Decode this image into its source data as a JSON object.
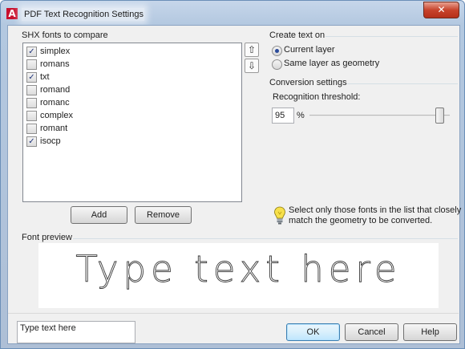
{
  "window": {
    "title": "PDF Text Recognition Settings",
    "close_glyph": "✕"
  },
  "fonts_group": {
    "label": "SHX fonts to compare",
    "items": [
      {
        "label": "simplex",
        "checked": true
      },
      {
        "label": "romans",
        "checked": false
      },
      {
        "label": "txt",
        "checked": true
      },
      {
        "label": "romand",
        "checked": false
      },
      {
        "label": "romanc",
        "checked": false
      },
      {
        "label": "complex",
        "checked": false
      },
      {
        "label": "romant",
        "checked": false
      },
      {
        "label": "isocp",
        "checked": true
      }
    ],
    "move_up_icon": "move-up-icon",
    "move_down_icon": "move-down-icon",
    "add_label": "Add",
    "remove_label": "Remove"
  },
  "create_text_on": {
    "label": "Create text on",
    "options": [
      {
        "label": "Current layer",
        "selected": true
      },
      {
        "label": "Same layer as geometry",
        "selected": false
      }
    ]
  },
  "conversion": {
    "label": "Conversion settings",
    "threshold_label": "Recognition threshold:",
    "threshold_value": "95",
    "unit": "%",
    "slider_fraction": 0.95
  },
  "hint": {
    "icon": "lightbulb-icon",
    "line1": "Select only those fonts in the list that closely",
    "line2": "match the geometry to be converted."
  },
  "preview": {
    "label": "Font preview",
    "sample": "Type text here"
  },
  "footer": {
    "sample_input_value": "Type text here",
    "ok_label": "OK",
    "cancel_label": "Cancel",
    "help_label": "Help"
  },
  "colors": {
    "accent": "#2a4a9a",
    "title_icon": "#c8102e"
  }
}
